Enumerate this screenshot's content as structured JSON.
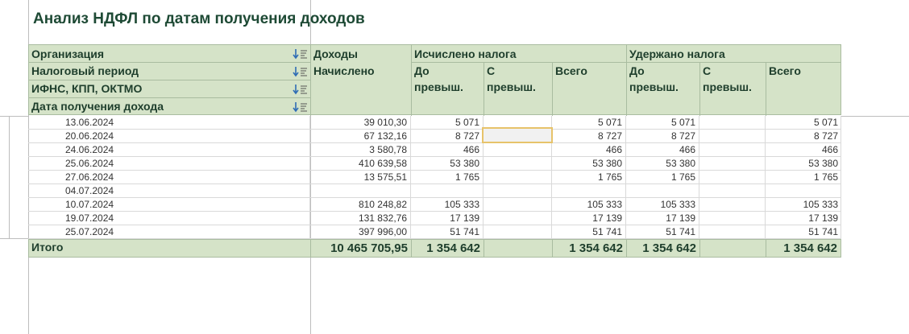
{
  "report": {
    "title": "Анализ НДФЛ по датам получения доходов"
  },
  "header": {
    "groupings": [
      {
        "label": "Организация",
        "icon": "sort-icon"
      },
      {
        "label": "Налоговый период",
        "icon": "sort-icon"
      },
      {
        "label": "ИФНС, КПП, ОКТМО",
        "icon": "sort-icon"
      },
      {
        "label": "Дата получения дохода",
        "icon": "sort-icon"
      }
    ],
    "income": "Доходы",
    "income_sub": "Начислено",
    "calculated": "Исчислено налога",
    "withheld": "Удержано налога",
    "before_excess": "До превыш.",
    "with_excess": "С превыш.",
    "total": "Всего"
  },
  "columns": [
    "date",
    "accrued",
    "calc_before",
    "calc_excess",
    "calc_total",
    "held_before",
    "held_excess",
    "held_total"
  ],
  "rows": [
    {
      "date": "13.06.2024",
      "accrued": "39 010,30",
      "calc_before": "5 071",
      "calc_excess": "",
      "calc_total": "5 071",
      "held_before": "5 071",
      "held_excess": "",
      "held_total": "5 071"
    },
    {
      "date": "20.06.2024",
      "accrued": "67 132,16",
      "calc_before": "8 727",
      "calc_excess": "",
      "calc_total": "8 727",
      "held_before": "8 727",
      "held_excess": "",
      "held_total": "8 727"
    },
    {
      "date": "24.06.2024",
      "accrued": "3 580,78",
      "calc_before": "466",
      "calc_excess": "",
      "calc_total": "466",
      "held_before": "466",
      "held_excess": "",
      "held_total": "466"
    },
    {
      "date": "25.06.2024",
      "accrued": "410 639,58",
      "calc_before": "53 380",
      "calc_excess": "",
      "calc_total": "53 380",
      "held_before": "53 380",
      "held_excess": "",
      "held_total": "53 380"
    },
    {
      "date": "27.06.2024",
      "accrued": "13 575,51",
      "calc_before": "1 765",
      "calc_excess": "",
      "calc_total": "1 765",
      "held_before": "1 765",
      "held_excess": "",
      "held_total": "1 765"
    },
    {
      "date": "04.07.2024",
      "accrued": "",
      "calc_before": "",
      "calc_excess": "",
      "calc_total": "",
      "held_before": "",
      "held_excess": "",
      "held_total": ""
    },
    {
      "date": "10.07.2024",
      "accrued": "810 248,82",
      "calc_before": "105 333",
      "calc_excess": "",
      "calc_total": "105 333",
      "held_before": "105 333",
      "held_excess": "",
      "held_total": "105 333"
    },
    {
      "date": "19.07.2024",
      "accrued": "131 832,76",
      "calc_before": "17 139",
      "calc_excess": "",
      "calc_total": "17 139",
      "held_before": "17 139",
      "held_excess": "",
      "held_total": "17 139"
    },
    {
      "date": "25.07.2024",
      "accrued": "397 996,00",
      "calc_before": "51 741",
      "calc_excess": "",
      "calc_total": "51 741",
      "held_before": "51 741",
      "held_excess": "",
      "held_total": "51 741"
    }
  ],
  "totals": {
    "label": "Итого",
    "accrued": "10 465 705,95",
    "calc_before": "1 354 642",
    "calc_excess": "",
    "calc_total": "1 354 642",
    "held_before": "1 354 642",
    "held_excess": "",
    "held_total": "1 354 642"
  },
  "colors": {
    "header_bg": "#d5e3c8",
    "header_text": "#1e3e2c",
    "title_text": "#1e4a35",
    "focus_border": "#e7c36a",
    "sort_icon": "#2f6db5"
  }
}
